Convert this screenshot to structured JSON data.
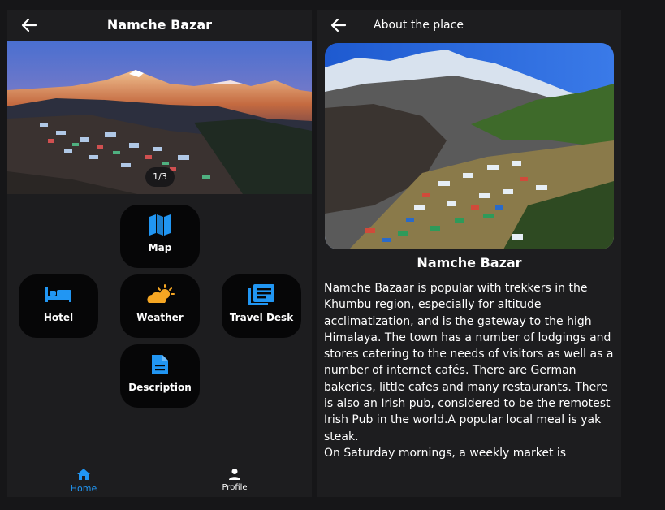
{
  "left": {
    "title": "Namche Bazar",
    "pager": "1/3",
    "tiles": [
      {
        "label": "Map",
        "icon": "map-icon"
      },
      {
        "label": "Hotel",
        "icon": "hotel-bed-icon"
      },
      {
        "label": "Weather",
        "icon": "weather-icon"
      },
      {
        "label": "Travel Desk",
        "icon": "travel-desk-icon"
      },
      {
        "label": "Description",
        "icon": "description-icon"
      }
    ],
    "nav": [
      {
        "label": "Home",
        "icon": "home-icon",
        "active": true
      },
      {
        "label": "Profile",
        "icon": "person-icon",
        "active": false
      }
    ]
  },
  "right": {
    "title": "About the place",
    "place_name": "Namche Bazar",
    "paragraphs": [
      "Namche Bazaar is popular with trekkers in the Khumbu region, especially for altitude acclimatization, and is the gateway to the high Himalaya. The town has a number of lodgings and stores catering to the needs of visitors as well as a number of internet cafés. There are German bakeries, little cafes and many restaurants. There is also an Irish pub, considered to be the remotest Irish Pub in the world.A popular local meal is yak steak.",
      "On Saturday mornings, a weekly market is"
    ]
  },
  "colors": {
    "accent": "#2196f3",
    "weather_sun": "#f5a623",
    "background": "#1d1d1f",
    "tile": "#060607"
  }
}
